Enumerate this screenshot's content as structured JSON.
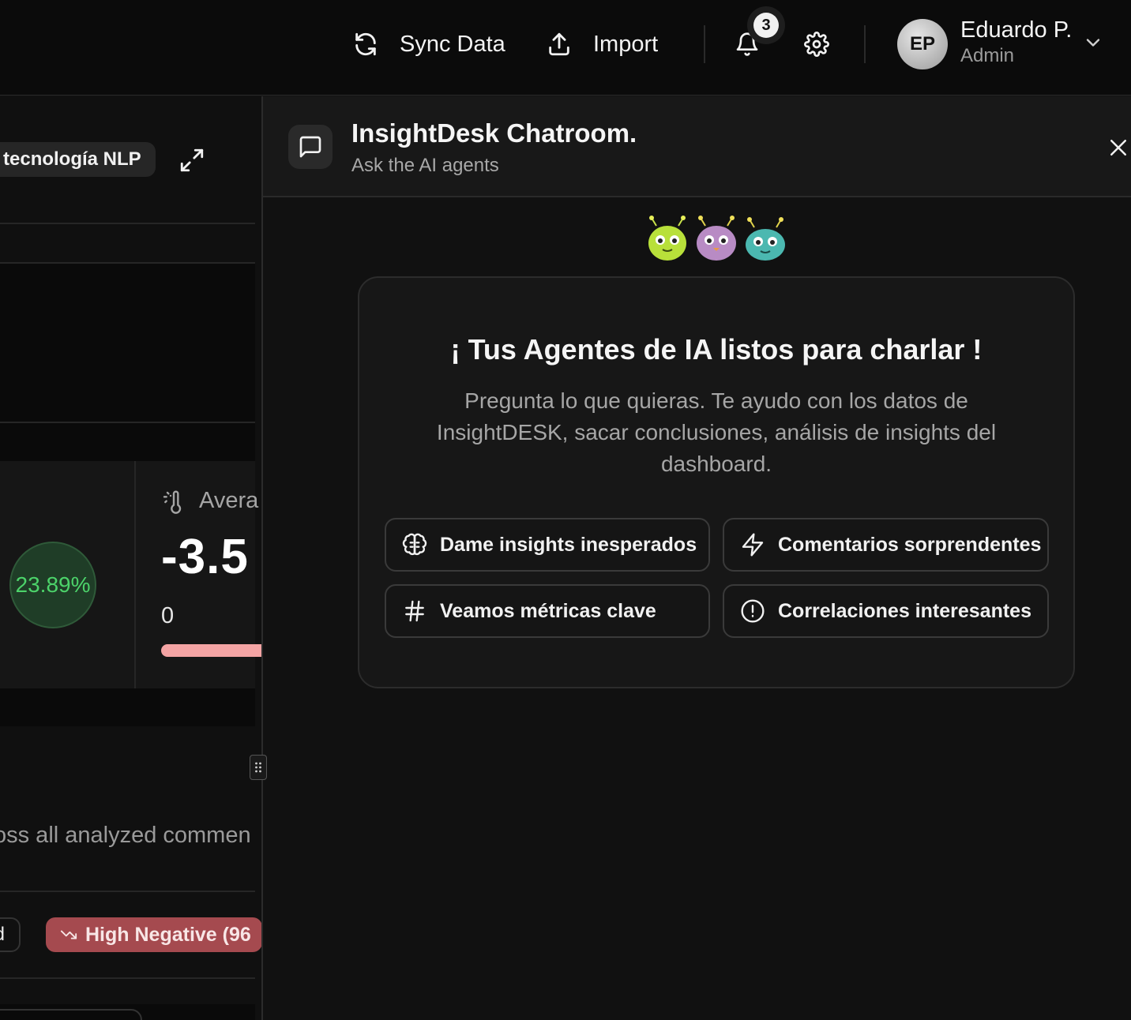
{
  "topbar": {
    "sync_label": "Sync Data",
    "import_label": "Import",
    "notification_count": "3",
    "user": {
      "initials": "EP",
      "name": "Eduardo P.",
      "role": "Admin"
    }
  },
  "dashboard": {
    "tech_pill": "tecnología NLP",
    "positive_pct": "23.89%",
    "average_label": "Avera",
    "average_value": "-3.5",
    "average_min": "0",
    "analyzed_text": "oss all analyzed commen",
    "filter_d": "d",
    "high_negative": "High Negative (96"
  },
  "chat": {
    "title": "InsightDesk Chatroom.",
    "subtitle": "Ask the AI agents",
    "heading": "¡ Tus Agentes de IA listos para charlar !",
    "description": "Pregunta lo que quieras. Te ayudo con los datos de InsightDESK, sacar conclusiones, análisis de insights del dashboard.",
    "suggestions": [
      {
        "label": "Dame insights inesperados",
        "icon": "brain-icon"
      },
      {
        "label": "Comentarios sorprendentes",
        "icon": "lightning-icon"
      },
      {
        "label": "Veamos métricas clave",
        "icon": "hash-icon"
      },
      {
        "label": "Correlaciones interesantes",
        "icon": "alert-circle-icon"
      }
    ]
  },
  "colors": {
    "positive": "#4cd36a",
    "negative_pill": "#a54a4f",
    "bar": "#f4a4a4"
  }
}
